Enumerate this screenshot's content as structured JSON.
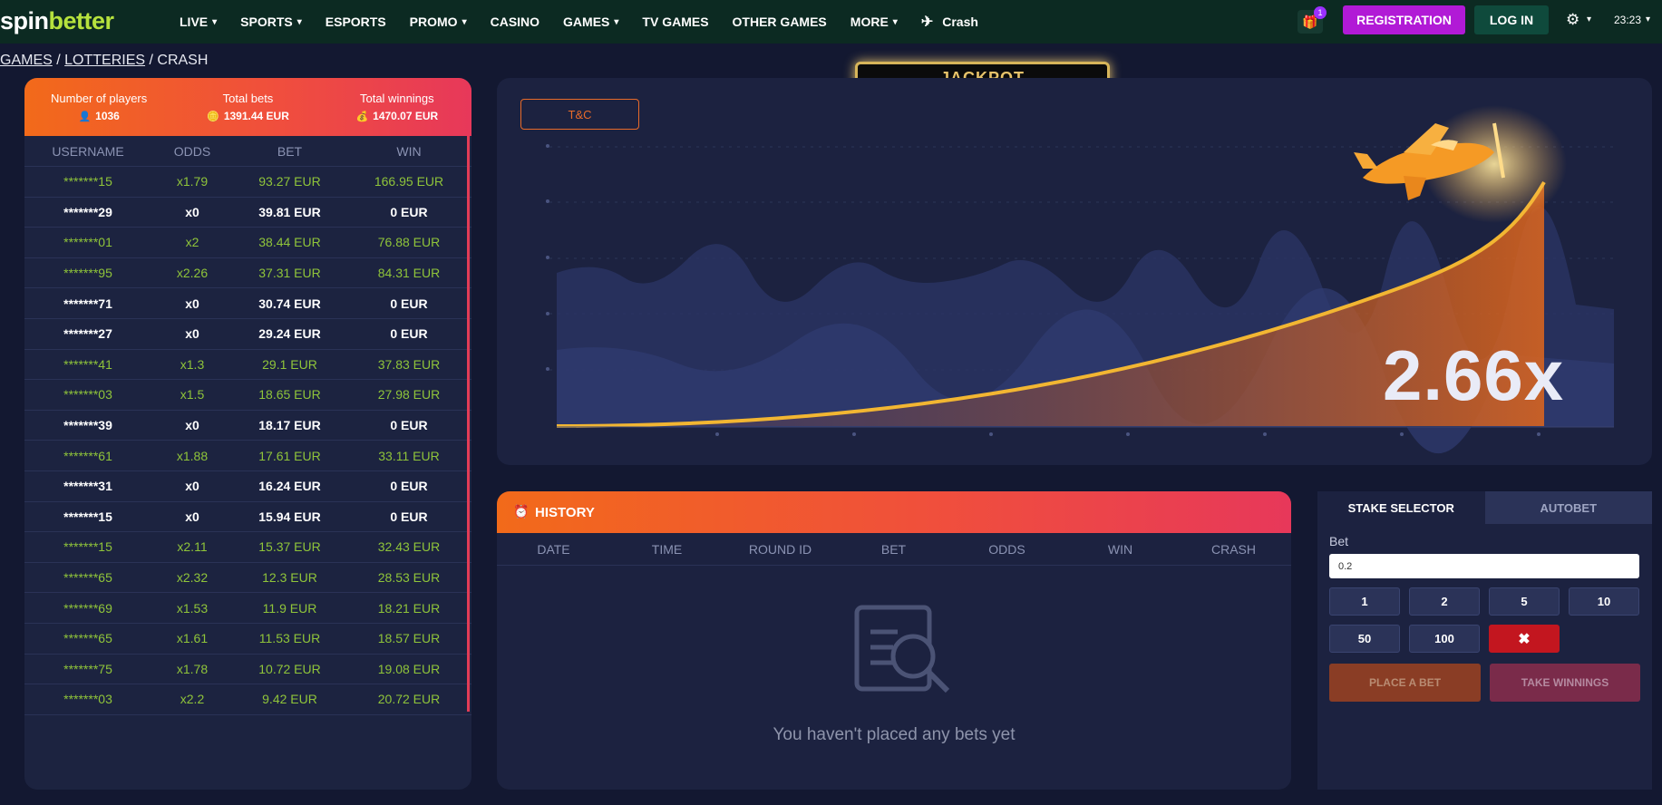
{
  "logo": {
    "part1": "spin",
    "part2": "better"
  },
  "nav": {
    "items": [
      {
        "label": "LIVE",
        "dropdown": true
      },
      {
        "label": "SPORTS",
        "dropdown": true
      },
      {
        "label": "ESPORTS",
        "dropdown": false
      },
      {
        "label": "PROMO",
        "dropdown": true
      },
      {
        "label": "CASINO",
        "dropdown": false
      },
      {
        "label": "GAMES",
        "dropdown": true
      },
      {
        "label": "TV GAMES",
        "dropdown": false
      },
      {
        "label": "OTHER GAMES",
        "dropdown": false
      },
      {
        "label": "MORE",
        "dropdown": true
      }
    ],
    "crash_label": "Crash",
    "gift_badge": "1",
    "registration_label": "REGISTRATION",
    "login_label": "LOG IN",
    "time": "23:23"
  },
  "breadcrumb": {
    "games": "GAMES",
    "lotteries": "LOTTERIES",
    "crash": "CRASH"
  },
  "players": {
    "stats": {
      "players_label": "Number of players",
      "players_value": "1036",
      "bets_label": "Total bets",
      "bets_value": "1391.44 EUR",
      "winnings_label": "Total winnings",
      "winnings_value": "1470.07 EUR"
    },
    "columns": {
      "username": "USERNAME",
      "odds": "ODDS",
      "bet": "BET",
      "win": "WIN"
    },
    "rows": [
      {
        "user": "*******15",
        "odds": "x1.79",
        "bet": "93.27 EUR",
        "win": "166.95 EUR",
        "won": true
      },
      {
        "user": "*******29",
        "odds": "x0",
        "bet": "39.81 EUR",
        "win": "0 EUR",
        "won": false
      },
      {
        "user": "*******01",
        "odds": "x2",
        "bet": "38.44 EUR",
        "win": "76.88 EUR",
        "won": true
      },
      {
        "user": "*******95",
        "odds": "x2.26",
        "bet": "37.31 EUR",
        "win": "84.31 EUR",
        "won": true
      },
      {
        "user": "*******71",
        "odds": "x0",
        "bet": "30.74 EUR",
        "win": "0 EUR",
        "won": false
      },
      {
        "user": "*******27",
        "odds": "x0",
        "bet": "29.24 EUR",
        "win": "0 EUR",
        "won": false
      },
      {
        "user": "*******41",
        "odds": "x1.3",
        "bet": "29.1 EUR",
        "win": "37.83 EUR",
        "won": true
      },
      {
        "user": "*******03",
        "odds": "x1.5",
        "bet": "18.65 EUR",
        "win": "27.98 EUR",
        "won": true
      },
      {
        "user": "*******39",
        "odds": "x0",
        "bet": "18.17 EUR",
        "win": "0 EUR",
        "won": false
      },
      {
        "user": "*******61",
        "odds": "x1.88",
        "bet": "17.61 EUR",
        "win": "33.11 EUR",
        "won": true
      },
      {
        "user": "*******31",
        "odds": "x0",
        "bet": "16.24 EUR",
        "win": "0 EUR",
        "won": false
      },
      {
        "user": "*******15",
        "odds": "x0",
        "bet": "15.94 EUR",
        "win": "0 EUR",
        "won": false
      },
      {
        "user": "*******15",
        "odds": "x2.11",
        "bet": "15.37 EUR",
        "win": "32.43 EUR",
        "won": true
      },
      {
        "user": "*******65",
        "odds": "x2.32",
        "bet": "12.3 EUR",
        "win": "28.53 EUR",
        "won": true
      },
      {
        "user": "*******69",
        "odds": "x1.53",
        "bet": "11.9 EUR",
        "win": "18.21 EUR",
        "won": true
      },
      {
        "user": "*******65",
        "odds": "x1.61",
        "bet": "11.53 EUR",
        "win": "18.57 EUR",
        "won": true
      },
      {
        "user": "*******75",
        "odds": "x1.78",
        "bet": "10.72 EUR",
        "win": "19.08 EUR",
        "won": true
      },
      {
        "user": "*******03",
        "odds": "x2.2",
        "bet": "9.42 EUR",
        "win": "20.72 EUR",
        "won": true
      }
    ]
  },
  "game": {
    "tc_label": "T&C",
    "jackpot_label": "JACKPOT",
    "multiplier": "2.66x"
  },
  "history": {
    "title": "HISTORY",
    "columns": [
      "DATE",
      "TIME",
      "ROUND ID",
      "BET",
      "ODDS",
      "WIN",
      "CRASH"
    ],
    "empty_text": "You haven't placed any bets yet"
  },
  "stake": {
    "tab_stake": "STAKE SELECTOR",
    "tab_autobet": "AUTOBET",
    "bet_label": "Bet",
    "bet_value": "0.2",
    "quick": [
      "1",
      "2",
      "5",
      "10",
      "50",
      "100"
    ],
    "place_label": "PLACE A BET",
    "take_label": "TAKE WINNINGS"
  },
  "colors": {
    "nav_bg": "#0c2a22",
    "accent_green": "#b6e23d",
    "win_green": "#8fc43a",
    "registration": "#b11ad6",
    "orange": "#f26a1a",
    "pink": "#e7385a"
  }
}
